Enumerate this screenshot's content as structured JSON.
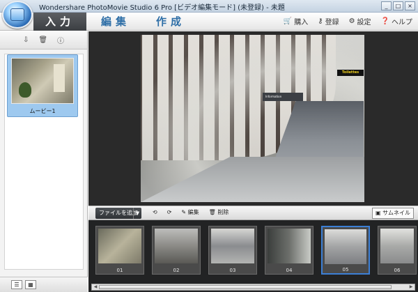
{
  "window": {
    "title": "Wondershare PhotoMovie Studio 6 Pro [ビデオ編集モード] (未登録) - 未題",
    "btn_min": "_",
    "btn_max": "□",
    "btn_close": "×"
  },
  "toolbar": {
    "tabs": [
      {
        "label": "入力"
      },
      {
        "label": "編集"
      },
      {
        "label": "作成"
      }
    ],
    "right": [
      {
        "icon": "cart-icon",
        "label": "購入"
      },
      {
        "icon": "key-icon",
        "label": "登録"
      },
      {
        "icon": "gear-icon",
        "label": "設定"
      },
      {
        "icon": "help-icon",
        "label": "ヘルプ"
      }
    ]
  },
  "left_panel": {
    "media": [
      {
        "label": "ムービー1"
      }
    ]
  },
  "edit_bar": {
    "add_file": "ファイルを追加",
    "edit": "編集",
    "delete": "削除",
    "thumbnail": "サムネイル"
  },
  "preview": {
    "sign_info": "Information",
    "sign_toilettes": "Toilettes"
  },
  "timeline": {
    "clips": [
      {
        "num": "01"
      },
      {
        "num": "02"
      },
      {
        "num": "03"
      },
      {
        "num": "04"
      },
      {
        "num": "05",
        "selected": true
      },
      {
        "num": "06"
      }
    ]
  },
  "colors": {
    "accent": "#3c7fd6",
    "tab_active": "#3b3e42",
    "tab_text": "#2f6fa7"
  }
}
